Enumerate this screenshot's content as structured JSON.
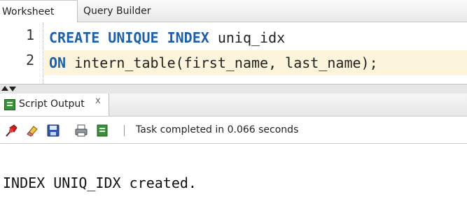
{
  "editor_tabs": [
    {
      "label": "Worksheet",
      "active": true
    },
    {
      "label": "Query Builder",
      "active": false
    }
  ],
  "code": {
    "lines": [
      {
        "number": "1",
        "tokens": [
          {
            "text": "CREATE",
            "type": "keyword"
          },
          {
            "text": " ",
            "type": "plain"
          },
          {
            "text": "UNIQUE",
            "type": "keyword"
          },
          {
            "text": " ",
            "type": "plain"
          },
          {
            "text": "INDEX",
            "type": "keyword"
          },
          {
            "text": " uniq_idx",
            "type": "plain"
          }
        ]
      },
      {
        "number": "2",
        "tokens": [
          {
            "text": "ON",
            "type": "keyword"
          },
          {
            "text": " intern_table(first_name, last_name);",
            "type": "plain"
          }
        ]
      }
    ],
    "highlighted_line": "2"
  },
  "output_tab": {
    "label": "Script Output",
    "close": "x"
  },
  "toolbar": {
    "icons": [
      "pin-icon",
      "eraser-icon",
      "save-icon",
      "print-icon",
      "export-icon"
    ],
    "status": "Task completed in 0.066 seconds"
  },
  "output_text": "INDEX UNIQ_IDX created.",
  "colors": {
    "keyword": "#1f5fa8",
    "current_line": "#fdf4dc"
  }
}
